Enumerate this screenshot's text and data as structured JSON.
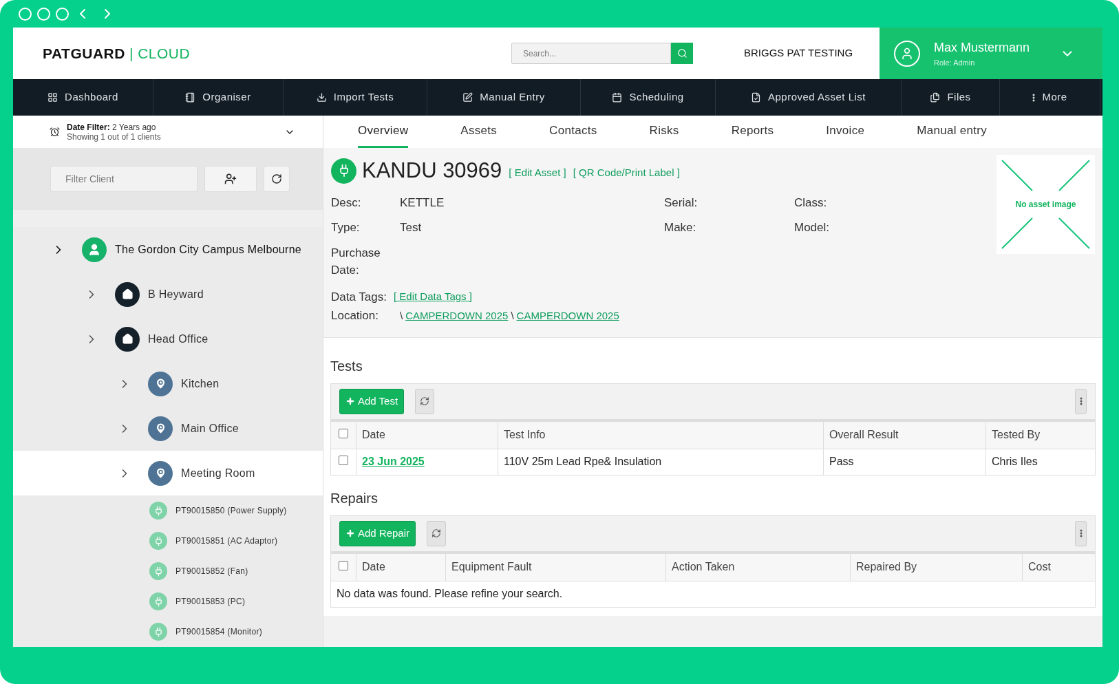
{
  "brand": {
    "name": "PATGUARD",
    "product": "| CLOUD"
  },
  "search": {
    "placeholder": "Search..."
  },
  "company": "BRIGGS PAT TESTING",
  "user": {
    "name": "Max Mustermann",
    "role": "Role: Admin"
  },
  "nav": [
    {
      "label": "Dashboard"
    },
    {
      "label": "Organiser"
    },
    {
      "label": "Import Tests"
    },
    {
      "label": "Manual Entry"
    },
    {
      "label": "Scheduling"
    },
    {
      "label": "Approved Asset List"
    },
    {
      "label": "Files"
    },
    {
      "label": "More"
    }
  ],
  "date_filter": {
    "label": "Date Filter:",
    "value": "2 Years ago",
    "summary": "Showing 1 out of 1 clients"
  },
  "filter_client": {
    "placeholder": "Filter Client"
  },
  "tree": [
    {
      "label": "The Gordon City Campus Melbourne",
      "kind": "client",
      "selected": false,
      "children": [
        {
          "label": "B Heyward",
          "kind": "site",
          "selected": false
        },
        {
          "label": "Head Office",
          "kind": "site",
          "selected": false,
          "children": [
            {
              "label": "Kitchen",
              "kind": "location",
              "selected": false
            },
            {
              "label": "Main Office",
              "kind": "location",
              "selected": false
            },
            {
              "label": "Meeting Room",
              "kind": "location",
              "selected": true,
              "children": [
                {
                  "label": "PT90015850 (Power Supply)",
                  "kind": "asset",
                  "selected": false
                },
                {
                  "label": "PT90015851 (AC Adaptor)",
                  "kind": "asset",
                  "selected": false
                },
                {
                  "label": "PT90015852 (Fan)",
                  "kind": "asset",
                  "selected": false
                },
                {
                  "label": "PT90015853 (PC)",
                  "kind": "asset",
                  "selected": false
                },
                {
                  "label": "PT90015854 (Monitor)",
                  "kind": "asset",
                  "selected": false
                }
              ]
            }
          ]
        }
      ]
    }
  ],
  "tabs": [
    {
      "label": "Overview",
      "selected": true
    },
    {
      "label": "Assets",
      "selected": false
    },
    {
      "label": "Contacts",
      "selected": false
    },
    {
      "label": "Risks",
      "selected": false
    },
    {
      "label": "Reports",
      "selected": false
    },
    {
      "label": "Invoice",
      "selected": false
    },
    {
      "label": "Manual entry",
      "selected": false
    }
  ],
  "asset": {
    "name": "KANDU 30969",
    "links": [
      "[ Edit Asset ]",
      "[ QR Code/Print Label ]"
    ],
    "detail_rows": [
      [
        {
          "label": "Desc:",
          "value": "KETTLE"
        },
        {
          "label": "Serial:"
        },
        {
          "label": "Class:"
        }
      ],
      [
        {
          "label": "Type:",
          "value": "Test"
        },
        {
          "label": "Make:"
        },
        {
          "label": "Model:"
        }
      ],
      [
        {
          "label": "Purchase Date:"
        }
      ]
    ],
    "data_tags": {
      "label": "Data Tags:",
      "link": "[ Edit Data Tags ]"
    },
    "location": {
      "label": "Location:",
      "separator": "\\",
      "path": [
        "CAMPERDOWN 2025",
        "CAMPERDOWN 2025"
      ]
    },
    "image_placeholder": "No asset image"
  },
  "tests": {
    "title": "Tests",
    "add_button": "Add Test",
    "all_checked": false,
    "columns": [
      "Date",
      "Test Info",
      "Overall Result",
      "Tested By"
    ],
    "rows": [
      {
        "checked": false,
        "cells": [
          "23 Jun 2025",
          "110V 25m Lead Rpe& Insulation",
          "Pass",
          "Chris Iles"
        ]
      }
    ]
  },
  "repairs": {
    "title": "Repairs",
    "add_button": "Add Repair",
    "all_checked": false,
    "columns": [
      "Date",
      "Equipment Fault",
      "Action Taken",
      "Repaired By",
      "Cost"
    ],
    "empty_message": "No data was found. Please refine your search."
  }
}
